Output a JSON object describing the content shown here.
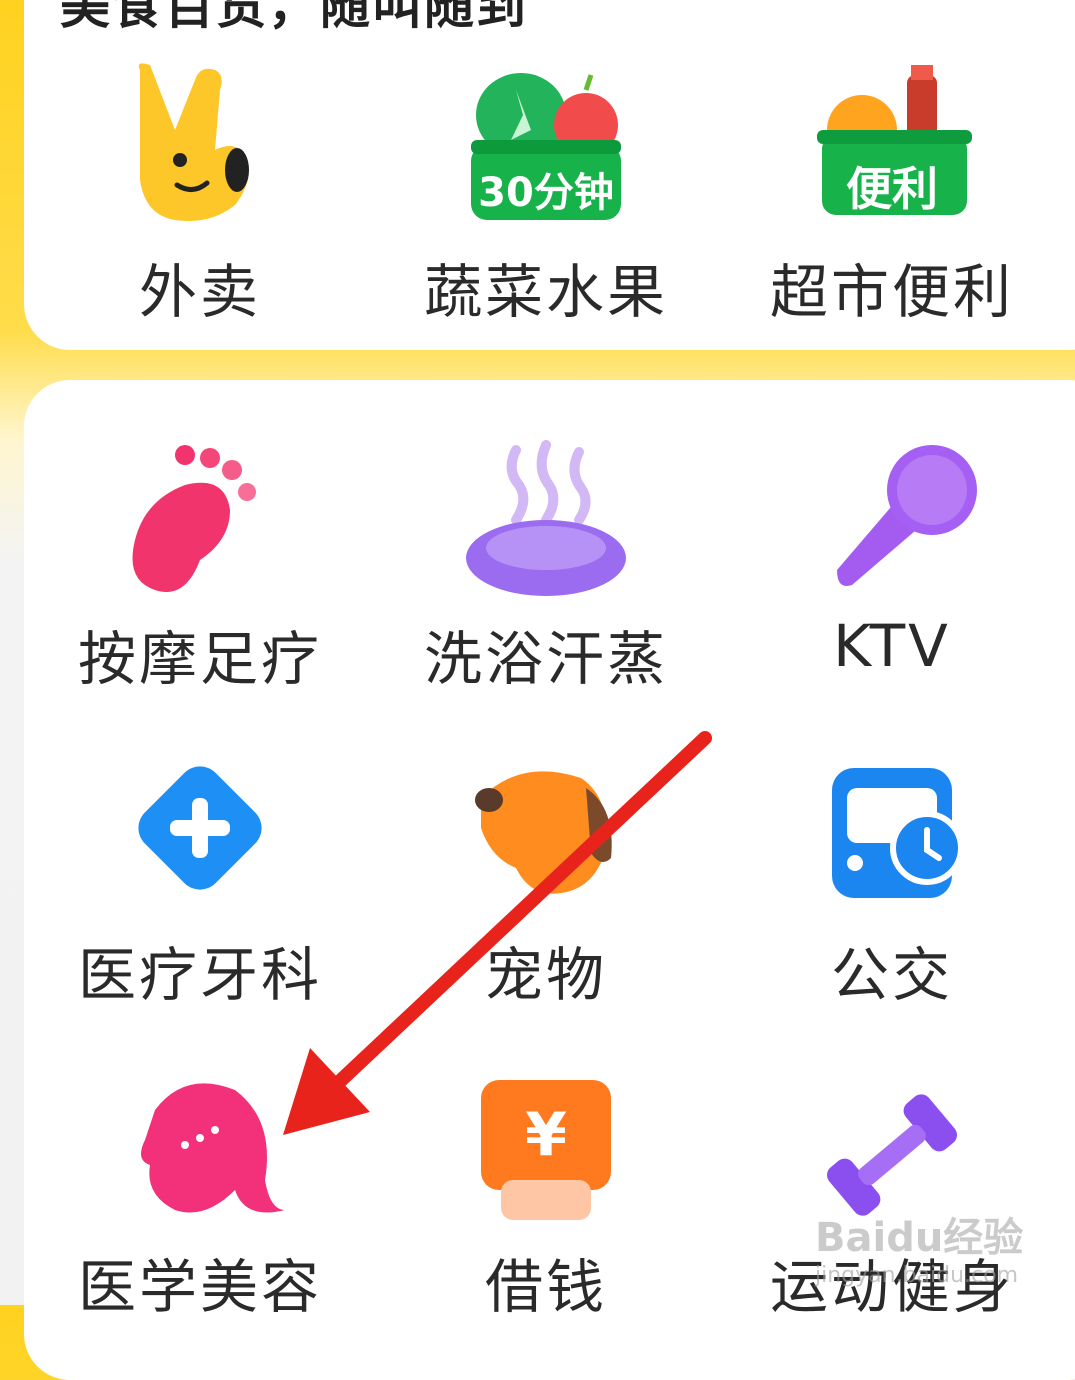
{
  "header": {
    "partial_text": "美食百货，随叫随到"
  },
  "top_row": [
    {
      "label": "外卖",
      "icon": "kangaroo-mascot-icon"
    },
    {
      "label": "蔬菜水果",
      "icon": "vegetable-basket-icon",
      "badge": "30分钟"
    },
    {
      "label": "超市便利",
      "icon": "grocery-basket-icon",
      "badge": "便利"
    }
  ],
  "grid": [
    {
      "label": "按摩足疗",
      "icon": "foot-icon"
    },
    {
      "label": "洗浴汗蒸",
      "icon": "bath-steam-icon"
    },
    {
      "label": "KTV",
      "icon": "microphone-icon"
    },
    {
      "label": "医疗牙科",
      "icon": "medical-cross-icon"
    },
    {
      "label": "宠物",
      "icon": "dog-icon"
    },
    {
      "label": "公交",
      "icon": "bus-clock-icon"
    },
    {
      "label": "医学美容",
      "icon": "beauty-face-icon"
    },
    {
      "label": "借钱",
      "icon": "yen-wallet-icon",
      "badge": "¥"
    },
    {
      "label": "运动健身",
      "icon": "dumbbell-icon"
    }
  ],
  "watermark": {
    "text": "Baidu经验",
    "subtext": "jingyan.baidu.com"
  },
  "colors": {
    "accent_yellow": "#ffd21f",
    "annotation_red": "#e8231c"
  }
}
